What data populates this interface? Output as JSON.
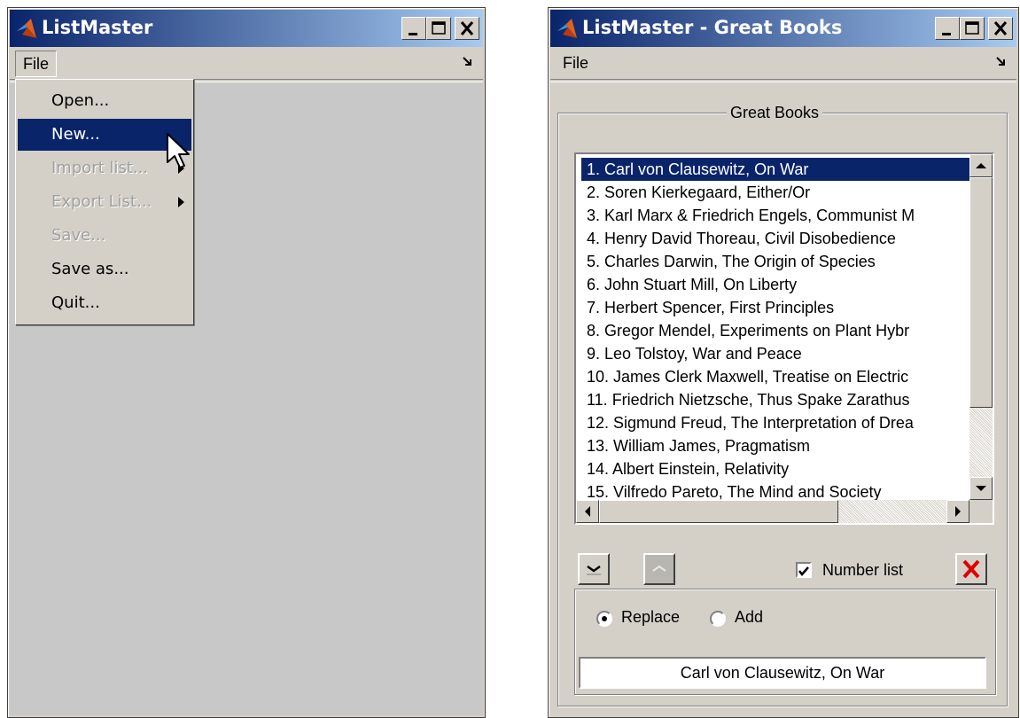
{
  "left_window": {
    "title": "ListMaster",
    "menu": {
      "file_label": "File"
    },
    "dropdown": [
      {
        "label": "Open...",
        "state": "normal"
      },
      {
        "label": "New...",
        "state": "highlighted"
      },
      {
        "label": "Import list...",
        "state": "disabled",
        "submenu": true
      },
      {
        "label": "Export List...",
        "state": "disabled",
        "submenu": true
      },
      {
        "label": "Save...",
        "state": "disabled"
      },
      {
        "label": "Save as...",
        "state": "normal"
      },
      {
        "label": "Quit...",
        "state": "normal"
      }
    ]
  },
  "right_window": {
    "title": "ListMaster - Great Books",
    "menu": {
      "file_label": "File"
    },
    "group_title": "Great Books",
    "list_items": [
      "1. Carl von Clausewitz, On War",
      "2. Soren Kierkegaard, Either/Or",
      "3. Karl Marx & Friedrich Engels, Communist M",
      "4. Henry David Thoreau, Civil Disobedience",
      "5. Charles Darwin, The Origin of Species",
      "6. John Stuart Mill, On Liberty",
      "7. Herbert Spencer, First Principles",
      "8. Gregor Mendel, Experiments on Plant Hybr",
      "9. Leo Tolstoy, War and Peace",
      "10. James Clerk Maxwell, Treatise on Electric",
      "11. Friedrich Nietzsche, Thus Spake Zarathus",
      "12. Sigmund Freud, The Interpretation of Drea",
      "13. William James, Pragmatism",
      "14. Albert Einstein, Relativity",
      "15. Vilfredo Pareto, The Mind and Society"
    ],
    "selected_index": 0,
    "number_list_label": "Number list",
    "number_list_checked": true,
    "radio_replace_label": "Replace",
    "radio_add_label": "Add",
    "radio_selected": "Replace",
    "edit_value": "Carl von Clausewitz, On War"
  },
  "colors": {
    "title_gradient_start": "#0a246a",
    "title_gradient_end": "#a6caf0",
    "window_face": "#d4d0c8",
    "selection": "#0a246a",
    "delete_red": "#e00000"
  }
}
